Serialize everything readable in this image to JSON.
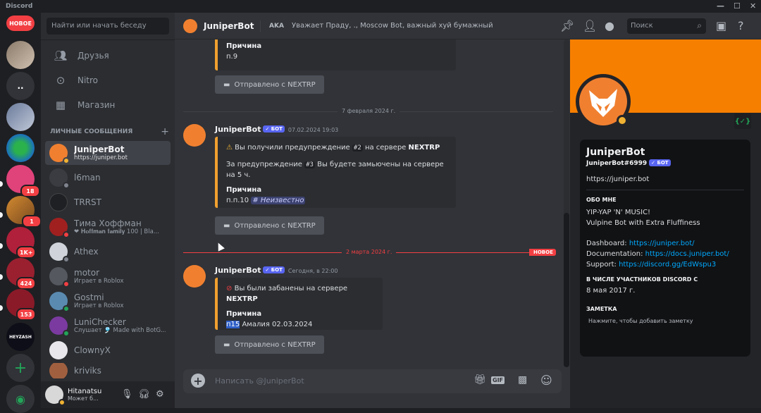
{
  "app": {
    "title": "Discord"
  },
  "guilds": {
    "new_label": "НОВОЕ",
    "items": [
      {
        "badge": ""
      },
      {
        "badge": ""
      },
      {
        "badge": ""
      },
      {
        "badge": ""
      },
      {
        "badge": "18"
      },
      {
        "badge": "1"
      },
      {
        "badge": "1K+"
      },
      {
        "badge": "424"
      },
      {
        "badge": "153"
      },
      {
        "badge": ""
      }
    ],
    "more_label": "..",
    "heyzash_label": "HEYZASH"
  },
  "dm_panel": {
    "search_placeholder": "Найти или начать беседу",
    "nav": [
      {
        "label": "Друзья"
      },
      {
        "label": "Nitro"
      },
      {
        "label": "Магазин"
      }
    ],
    "header": "ЛИЧНЫЕ СООБЩЕНИЯ",
    "add": "+",
    "dms": [
      {
        "name": "JuniperBot",
        "sub": "https://juniper.bot"
      },
      {
        "name": "l6man",
        "sub": ""
      },
      {
        "name": "TRRST",
        "sub": ""
      },
      {
        "name": "Тима Хоффман",
        "sub": "❤ 𝐇𝐨𝐟𝐟𝐦𝐚𝐧 𝐟𝐚𝐦𝐢𝐥𝐲 100 | Bla..."
      },
      {
        "name": "Athex",
        "sub": ""
      },
      {
        "name": "motor",
        "sub": "Играет в Roblox"
      },
      {
        "name": "Gostmi",
        "sub": "Играет в Roblox"
      },
      {
        "name": "LuniChecker",
        "sub": "Слушает 🎐 Made with BotG..."
      },
      {
        "name": "ClownyX",
        "sub": ""
      },
      {
        "name": "kriviks",
        "sub": ""
      }
    ],
    "user": {
      "name": "Hitanatsu",
      "status": "Может б..."
    }
  },
  "header": {
    "channel_name": "JuniperBot",
    "aka_label": "AKA",
    "aka_names": "Уважает Праду, ., Moscow Bot, важный хуй бумажный",
    "search_placeholder": "Поиск"
  },
  "messages": {
    "top_embed": {
      "field_title": "Причина",
      "field_value": "п.9"
    },
    "sent_button": "Отправлено с NEXTRP",
    "divider1": "7 февраля 2024 г.",
    "msg1": {
      "author": "JuniperBot",
      "bot_tag": "БОТ",
      "time": "07.02.2024 19:03",
      "warn_pre": "Вы получили предупреждение",
      "warn_num": "#2",
      "warn_mid": "на сервере",
      "server": "NEXTRP",
      "line2_pre": "За предупреждение",
      "line2_num": "#3",
      "line2_post": "Вы будете замьючены на сервере на 5 ч.",
      "field_title": "Причина",
      "field_value": "п.п.10",
      "channel_mention": "# Неизвестно"
    },
    "divider2": "2 марта 2024 г.",
    "new_label": "НОВОЕ",
    "msg2": {
      "author": "JuniperBot",
      "bot_tag": "БОТ",
      "time": "Сегодня, в 22:00",
      "ban_pre": "Вы были забанены на сервере",
      "server": "NEXTRP",
      "field_title": "Причина",
      "field_hl": "п15",
      "field_rest": "Амалия 02.03.2024"
    },
    "input_placeholder": "Написать @JuniperBot"
  },
  "profile": {
    "name": "JuniperBot",
    "tag": "JuniperBot#6999",
    "bot_tag": "БОТ",
    "link": "https://juniper.bot",
    "about_title": "ОБО МНЕ",
    "about_line1": "YIP-YAP 'N' MUSIC!",
    "about_line2": "Vulpine Bot with Extra Fluffiness",
    "dash_label": "Dashboard:",
    "dash_url": "https://juniper.bot/",
    "doc_label": "Documentation:",
    "doc_url": "https://docs.juniper.bot/",
    "sup_label": "Support:",
    "sup_url": "https://discord.gg/EdWspu3",
    "member_title": "В ЧИСЛЕ УЧАСТНИКОВ DISCORD С",
    "member_date": "8 мая 2017 г.",
    "note_title": "ЗАМЕТКА",
    "note_placeholder": "Нажмите, чтобы добавить заметку",
    "badge_text": "{✓}"
  },
  "colors": {
    "accent": "#5865f2",
    "banner": "#f77f00",
    "embed_border": "#f0a030",
    "new_red": "#f23f43"
  }
}
